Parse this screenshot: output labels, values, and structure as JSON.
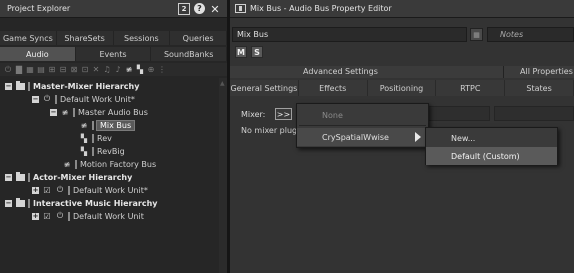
{
  "left_pane": {
    "title": "Project Explorer",
    "badge": "2",
    "help_glyph": "?",
    "close_glyph": "✕",
    "tabs_top": [
      "Game Syncs",
      "ShareSets",
      "Sessions",
      "Queries"
    ],
    "tabs_bottom": [
      {
        "label": "Audio",
        "active": true
      },
      {
        "label": "Events",
        "active": false
      },
      {
        "label": "SoundBanks",
        "active": false
      }
    ],
    "tree": {
      "master_mixer": "Master-Mixer Hierarchy",
      "default_work_unit_master": "Default Work Unit*",
      "master_audio_bus": "Master Audio Bus",
      "mix_bus": "Mix Bus",
      "rev": "Rev",
      "revbig": "RevBig",
      "motion_factory_bus": "Motion Factory Bus",
      "actor_mixer": "Actor-Mixer Hierarchy",
      "default_work_unit_actor": "Default Work Unit*",
      "interactive_music": "Interactive Music Hierarchy",
      "default_work_unit_music": "Default Work Unit",
      "expand_glyph": "−",
      "collapsed_glyph": "+"
    }
  },
  "right_pane": {
    "title": "Mix Bus - Audio Bus Property Editor",
    "name_value": "Mix Bus",
    "notes_placeholder": "Notes",
    "mute_label": "M",
    "solo_label": "S",
    "advanced_settings": "Advanced Settings",
    "all_properties": "All Properties",
    "tabs": [
      {
        "label": "General Settings",
        "active": false
      },
      {
        "label": "Effects",
        "active": false
      },
      {
        "label": "Positioning",
        "active": false
      },
      {
        "label": "RTPC",
        "active": false
      },
      {
        "label": "States",
        "active": false
      }
    ],
    "mixer_label": "Mixer:",
    "mixer_button": ">>",
    "no_mixer_text": "No mixer plug"
  },
  "context_menu": {
    "items": [
      "None",
      "CrySpatialWwise"
    ],
    "submenu": [
      "New...",
      "Default (Custom)"
    ]
  },
  "colors": {
    "background": "#1d1d1d",
    "panel": "#262626",
    "selection": "#5a5a5a",
    "text": "#cfcfcf"
  },
  "icons": [
    "question-icon",
    "close-icon",
    "audio-bus-icon",
    "folder-icon",
    "work-unit-icon",
    "submenu-arrow-icon"
  ]
}
